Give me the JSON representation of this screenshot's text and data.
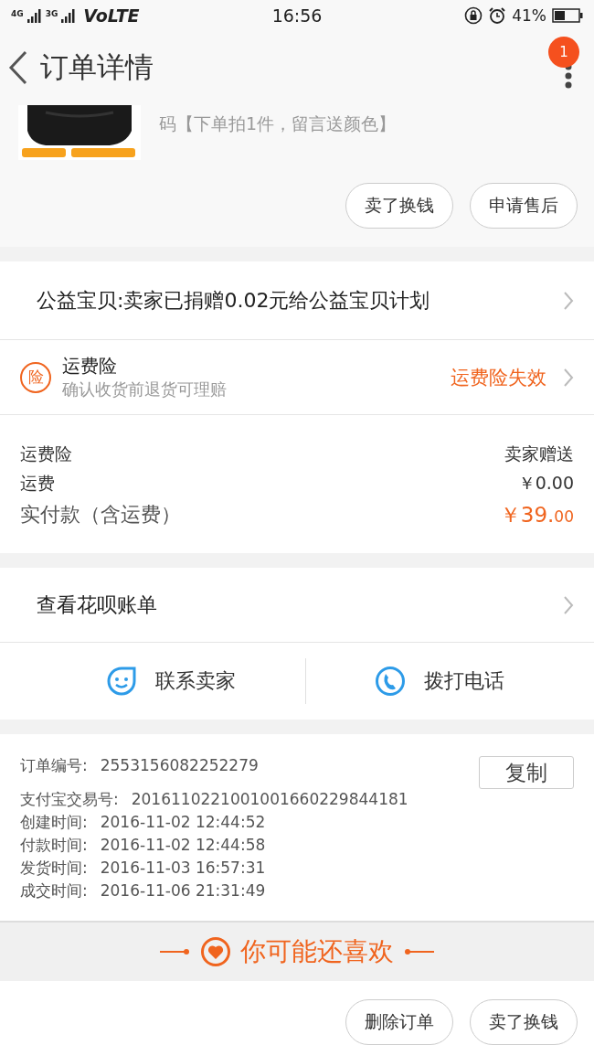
{
  "status_bar": {
    "network_1": "4G",
    "network_2": "3G",
    "volte": "VoLTE",
    "time": "16:56",
    "battery": "41%"
  },
  "header": {
    "title": "订单详情",
    "badge": "1"
  },
  "product": {
    "title": "码【下单拍1件，留言送颜色】",
    "image": {
      "kind": "picture"
    },
    "buttons": [
      "卖了换钱",
      "申请售后"
    ]
  },
  "charity": {
    "text": "公益宝贝:卖家已捐赠0.02元给公益宝贝计划"
  },
  "insurance": {
    "icon_text": "险",
    "title": "运费险",
    "subtitle": "确认收货前退货可理赔",
    "status": "运费险失效"
  },
  "fees": [
    {
      "label": "运费险",
      "value": "卖家赠送",
      "kind": "plain"
    },
    {
      "label": "运费",
      "value": "￥0.00",
      "kind": "plain"
    },
    {
      "label": "实付款（含运费）",
      "value": "￥39.",
      "value_small": "00",
      "kind": "total"
    }
  ],
  "huabei": {
    "text": "查看花呗账单"
  },
  "contact": [
    {
      "label": "联系卖家",
      "kind": "chat"
    },
    {
      "label": "拨打电话",
      "kind": "phone"
    }
  ],
  "order_info": {
    "copy_button": "复制",
    "rows": [
      {
        "label": "订单编号:",
        "value": "2553156082252279"
      },
      {
        "label": "支付宝交易号:",
        "value": "2016110221001001660229844181"
      },
      {
        "label": "创建时间:",
        "value": "2016-11-02 12:44:52"
      },
      {
        "label": "付款时间:",
        "value": "2016-11-02 12:44:58"
      },
      {
        "label": "发货时间:",
        "value": "2016-11-03 16:57:31"
      },
      {
        "label": "成交时间:",
        "value": "2016-11-06 21:31:49"
      }
    ]
  },
  "recommend": {
    "title": "你可能还喜欢"
  },
  "bottom_buttons": [
    "删除订单",
    "卖了换钱"
  ]
}
